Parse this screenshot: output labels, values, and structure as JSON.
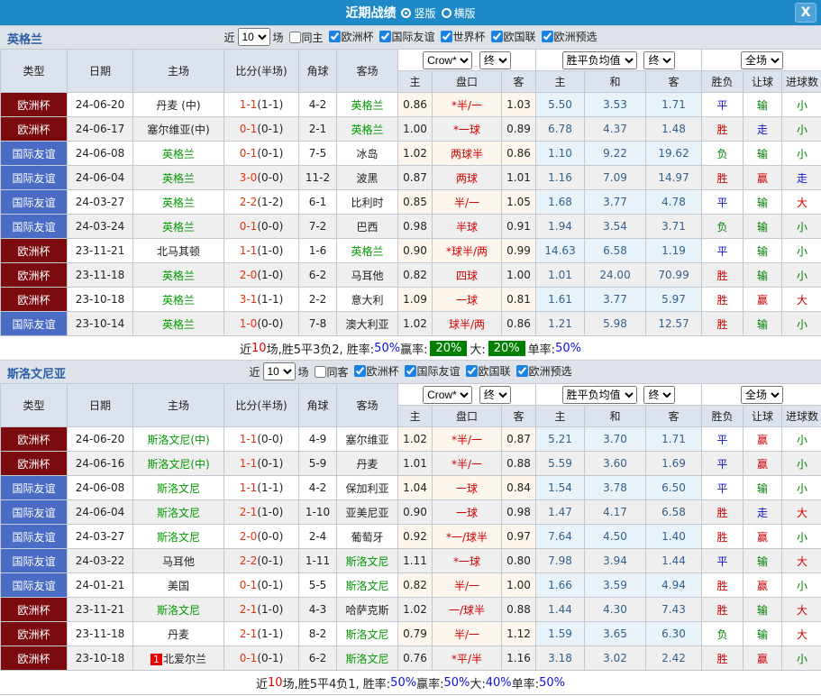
{
  "title_bar": {
    "title": "近期战绩",
    "view_options": [
      {
        "label": "竖版",
        "selected": true
      },
      {
        "label": "横版",
        "selected": false
      }
    ],
    "close_label": "X"
  },
  "colors": {
    "titlebar_bg": "#1e8bc8",
    "europe_cup_bg": "#7c0b10",
    "friendly_bg": "#4b6cc4",
    "team_highlight": "#009900",
    "score_ft": "#e53311",
    "handicap_text": "#d40000",
    "avg_text": "#33618c",
    "badge_bg": "#008000"
  },
  "type_colors": {
    "欧洲杯": "#7c0b10",
    "国际友谊": "#4b6cc4"
  },
  "result_colors": {
    "胜": "#cc0000",
    "平": "#1111cc",
    "负": "#008000",
    "赢": "#cc0000",
    "走": "#1111cc",
    "输": "#008000",
    "大": "#cc0000",
    "小": "#008000"
  },
  "table_headers": {
    "type": "类型",
    "date": "日期",
    "home": "主场",
    "score": "比分(半场)",
    "corner": "角球",
    "away": "客场",
    "odds_company": "Crow*",
    "final": "终",
    "avg": "胜平负均值",
    "full": "全场",
    "sub": [
      "主",
      "盘口",
      "客",
      "主",
      "和",
      "客",
      "胜负",
      "让球",
      "进球数"
    ]
  },
  "sections": [
    {
      "team": "英格兰",
      "filter": {
        "recent_label": "近",
        "recent_value": "10",
        "matches_label": "场",
        "same_venue": {
          "label": "同主",
          "checked": false
        },
        "competitions": [
          {
            "label": "欧洲杯",
            "checked": true
          },
          {
            "label": "国际友谊",
            "checked": true
          },
          {
            "label": "世界杯",
            "checked": true
          },
          {
            "label": "欧国联",
            "checked": true
          },
          {
            "label": "欧洲预选",
            "checked": true
          }
        ]
      },
      "rows": [
        {
          "type": "欧洲杯",
          "date": "24-06-20",
          "home": "丹麦 (中)",
          "home_hl": false,
          "score_ft": "1-1",
          "score_ht": "(1-1)",
          "corner": "4-2",
          "away": "英格兰",
          "away_hl": true,
          "odds_home": "0.86",
          "handicap": "*半/一",
          "odds_away": "1.03",
          "avg_home": "5.50",
          "avg_draw": "3.53",
          "avg_away": "1.71",
          "res_wdl": "平",
          "res_handicap": "输",
          "res_goal": "小"
        },
        {
          "type": "欧洲杯",
          "date": "24-06-17",
          "home": "塞尔维亚(中)",
          "home_hl": false,
          "score_ft": "0-1",
          "score_ht": "(0-1)",
          "corner": "2-1",
          "away": "英格兰",
          "away_hl": true,
          "odds_home": "1.00",
          "handicap": "*一球",
          "odds_away": "0.89",
          "avg_home": "6.78",
          "avg_draw": "4.37",
          "avg_away": "1.48",
          "res_wdl": "胜",
          "res_handicap": "走",
          "res_goal": "小"
        },
        {
          "type": "国际友谊",
          "date": "24-06-08",
          "home": "英格兰",
          "home_hl": true,
          "score_ft": "0-1",
          "score_ht": "(0-1)",
          "corner": "7-5",
          "away": "冰岛",
          "away_hl": false,
          "odds_home": "1.02",
          "handicap": "两球半",
          "odds_away": "0.86",
          "avg_home": "1.10",
          "avg_draw": "9.22",
          "avg_away": "19.62",
          "res_wdl": "负",
          "res_handicap": "输",
          "res_goal": "小"
        },
        {
          "type": "国际友谊",
          "date": "24-06-04",
          "home": "英格兰",
          "home_hl": true,
          "score_ft": "3-0",
          "score_ht": "(0-0)",
          "corner": "11-2",
          "away": "波黑",
          "away_hl": false,
          "odds_home": "0.87",
          "handicap": "两球",
          "odds_away": "1.01",
          "avg_home": "1.16",
          "avg_draw": "7.09",
          "avg_away": "14.97",
          "res_wdl": "胜",
          "res_handicap": "赢",
          "res_goal": "走"
        },
        {
          "type": "国际友谊",
          "date": "24-03-27",
          "home": "英格兰",
          "home_hl": true,
          "score_ft": "2-2",
          "score_ht": "(1-2)",
          "corner": "6-1",
          "away": "比利时",
          "away_hl": false,
          "odds_home": "0.85",
          "handicap": "半/一",
          "odds_away": "1.05",
          "avg_home": "1.68",
          "avg_draw": "3.77",
          "avg_away": "4.78",
          "res_wdl": "平",
          "res_handicap": "输",
          "res_goal": "大"
        },
        {
          "type": "国际友谊",
          "date": "24-03-24",
          "home": "英格兰",
          "home_hl": true,
          "score_ft": "0-1",
          "score_ht": "(0-0)",
          "corner": "7-2",
          "away": "巴西",
          "away_hl": false,
          "odds_home": "0.98",
          "handicap": "半球",
          "odds_away": "0.91",
          "avg_home": "1.94",
          "avg_draw": "3.54",
          "avg_away": "3.71",
          "res_wdl": "负",
          "res_handicap": "输",
          "res_goal": "小"
        },
        {
          "type": "欧洲杯",
          "date": "23-11-21",
          "home": "北马其顿",
          "home_hl": false,
          "score_ft": "1-1",
          "score_ht": "(1-0)",
          "corner": "1-6",
          "away": "英格兰",
          "away_hl": true,
          "odds_home": "0.90",
          "handicap": "*球半/两",
          "odds_away": "0.99",
          "avg_home": "14.63",
          "avg_draw": "6.58",
          "avg_away": "1.19",
          "res_wdl": "平",
          "res_handicap": "输",
          "res_goal": "小"
        },
        {
          "type": "欧洲杯",
          "date": "23-11-18",
          "home": "英格兰",
          "home_hl": true,
          "score_ft": "2-0",
          "score_ht": "(1-0)",
          "corner": "6-2",
          "away": "马耳他",
          "away_hl": false,
          "odds_home": "0.82",
          "handicap": "四球",
          "odds_away": "1.00",
          "avg_home": "1.01",
          "avg_draw": "24.00",
          "avg_away": "70.99",
          "res_wdl": "胜",
          "res_handicap": "输",
          "res_goal": "小"
        },
        {
          "type": "欧洲杯",
          "date": "23-10-18",
          "home": "英格兰",
          "home_hl": true,
          "score_ft": "3-1",
          "score_ht": "(1-1)",
          "corner": "2-2",
          "away": "意大利",
          "away_hl": false,
          "odds_home": "1.09",
          "handicap": "一球",
          "odds_away": "0.81",
          "avg_home": "1.61",
          "avg_draw": "3.77",
          "avg_away": "5.97",
          "res_wdl": "胜",
          "res_handicap": "赢",
          "res_goal": "大"
        },
        {
          "type": "国际友谊",
          "date": "23-10-14",
          "home": "英格兰",
          "home_hl": true,
          "score_ft": "1-0",
          "score_ht": "(0-0)",
          "corner": "7-8",
          "away": "澳大利亚",
          "away_hl": false,
          "odds_home": "1.02",
          "handicap": "球半/两",
          "odds_away": "0.86",
          "avg_home": "1.21",
          "avg_draw": "5.98",
          "avg_away": "12.57",
          "res_wdl": "胜",
          "res_handicap": "输",
          "res_goal": "小"
        }
      ],
      "summary": [
        {
          "text": "近",
          "style": "plain"
        },
        {
          "text": "10",
          "style": "red"
        },
        {
          "text": "场,胜5平3负2, 胜率:",
          "style": "plain"
        },
        {
          "text": "50%",
          "style": "blue"
        },
        {
          "text": " 赢率:",
          "style": "plain"
        },
        {
          "text": "20%",
          "style": "badge"
        },
        {
          "text": " 大:",
          "style": "plain"
        },
        {
          "text": "20%",
          "style": "badge"
        },
        {
          "text": " 单率:",
          "style": "plain"
        },
        {
          "text": "50%",
          "style": "blue"
        }
      ]
    },
    {
      "team": "斯洛文尼亚",
      "filter": {
        "recent_label": "近",
        "recent_value": "10",
        "matches_label": "场",
        "same_venue": {
          "label": "同客",
          "checked": false
        },
        "competitions": [
          {
            "label": "欧洲杯",
            "checked": true
          },
          {
            "label": "国际友谊",
            "checked": true
          },
          {
            "label": "欧国联",
            "checked": true
          },
          {
            "label": "欧洲预选",
            "checked": true
          }
        ]
      },
      "rows": [
        {
          "type": "欧洲杯",
          "date": "24-06-20",
          "home": "斯洛文尼(中)",
          "home_hl": true,
          "score_ft": "1-1",
          "score_ht": "(0-0)",
          "corner": "4-9",
          "away": "塞尔维亚",
          "away_hl": false,
          "odds_home": "1.02",
          "handicap": "*半/一",
          "odds_away": "0.87",
          "avg_home": "5.21",
          "avg_draw": "3.70",
          "avg_away": "1.71",
          "res_wdl": "平",
          "res_handicap": "赢",
          "res_goal": "小"
        },
        {
          "type": "欧洲杯",
          "date": "24-06-16",
          "home": "斯洛文尼(中)",
          "home_hl": true,
          "score_ft": "1-1",
          "score_ht": "(0-1)",
          "corner": "5-9",
          "away": "丹麦",
          "away_hl": false,
          "odds_home": "1.01",
          "handicap": "*半/一",
          "odds_away": "0.88",
          "avg_home": "5.59",
          "avg_draw": "3.60",
          "avg_away": "1.69",
          "res_wdl": "平",
          "res_handicap": "赢",
          "res_goal": "小"
        },
        {
          "type": "国际友谊",
          "date": "24-06-08",
          "home": "斯洛文尼",
          "home_hl": true,
          "score_ft": "1-1",
          "score_ht": "(1-1)",
          "corner": "4-2",
          "away": "保加利亚",
          "away_hl": false,
          "odds_home": "1.04",
          "handicap": "一球",
          "odds_away": "0.84",
          "avg_home": "1.54",
          "avg_draw": "3.78",
          "avg_away": "6.50",
          "res_wdl": "平",
          "res_handicap": "输",
          "res_goal": "小"
        },
        {
          "type": "国际友谊",
          "date": "24-06-04",
          "home": "斯洛文尼",
          "home_hl": true,
          "score_ft": "2-1",
          "score_ht": "(1-0)",
          "corner": "1-10",
          "away": "亚美尼亚",
          "away_hl": false,
          "odds_home": "0.90",
          "handicap": "一球",
          "odds_away": "0.98",
          "avg_home": "1.47",
          "avg_draw": "4.17",
          "avg_away": "6.58",
          "res_wdl": "胜",
          "res_handicap": "走",
          "res_goal": "大"
        },
        {
          "type": "国际友谊",
          "date": "24-03-27",
          "home": "斯洛文尼",
          "home_hl": true,
          "score_ft": "2-0",
          "score_ht": "(0-0)",
          "corner": "2-4",
          "away": "葡萄牙",
          "away_hl": false,
          "odds_home": "0.92",
          "handicap": "*一/球半",
          "odds_away": "0.97",
          "avg_home": "7.64",
          "avg_draw": "4.50",
          "avg_away": "1.40",
          "res_wdl": "胜",
          "res_handicap": "赢",
          "res_goal": "小"
        },
        {
          "type": "国际友谊",
          "date": "24-03-22",
          "home": "马耳他",
          "home_hl": false,
          "score_ft": "2-2",
          "score_ht": "(0-1)",
          "corner": "1-11",
          "away": "斯洛文尼",
          "away_hl": true,
          "odds_home": "1.11",
          "handicap": "*一球",
          "odds_away": "0.80",
          "avg_home": "7.98",
          "avg_draw": "3.94",
          "avg_away": "1.44",
          "res_wdl": "平",
          "res_handicap": "输",
          "res_goal": "大"
        },
        {
          "type": "国际友谊",
          "date": "24-01-21",
          "home": "美国",
          "home_hl": false,
          "score_ft": "0-1",
          "score_ht": "(0-1)",
          "corner": "5-5",
          "away": "斯洛文尼",
          "away_hl": true,
          "odds_home": "0.82",
          "handicap": "半/一",
          "odds_away": "1.00",
          "avg_home": "1.66",
          "avg_draw": "3.59",
          "avg_away": "4.94",
          "res_wdl": "胜",
          "res_handicap": "赢",
          "res_goal": "小"
        },
        {
          "type": "欧洲杯",
          "date": "23-11-21",
          "home": "斯洛文尼",
          "home_hl": true,
          "score_ft": "2-1",
          "score_ht": "(1-0)",
          "corner": "4-3",
          "away": "哈萨克斯",
          "away_hl": false,
          "odds_home": "1.02",
          "handicap": "一/球半",
          "odds_away": "0.88",
          "avg_home": "1.44",
          "avg_draw": "4.30",
          "avg_away": "7.43",
          "res_wdl": "胜",
          "res_handicap": "输",
          "res_goal": "大"
        },
        {
          "type": "欧洲杯",
          "date": "23-11-18",
          "home": "丹麦",
          "home_hl": false,
          "score_ft": "2-1",
          "score_ht": "(1-1)",
          "corner": "8-2",
          "away": "斯洛文尼",
          "away_hl": true,
          "odds_home": "0.79",
          "handicap": "半/一",
          "odds_away": "1.12",
          "avg_home": "1.59",
          "avg_draw": "3.65",
          "avg_away": "6.30",
          "res_wdl": "负",
          "res_handicap": "输",
          "res_goal": "大"
        },
        {
          "type": "欧洲杯",
          "date": "23-10-18",
          "home": "北爱尔兰",
          "home_hl": false,
          "home_red": "1",
          "score_ft": "0-1",
          "score_ht": "(0-1)",
          "corner": "6-2",
          "away": "斯洛文尼",
          "away_hl": true,
          "odds_home": "0.76",
          "handicap": "*平/半",
          "odds_away": "1.16",
          "avg_home": "3.18",
          "avg_draw": "3.02",
          "avg_away": "2.42",
          "res_wdl": "胜",
          "res_handicap": "赢",
          "res_goal": "小"
        }
      ],
      "summary": [
        {
          "text": "近",
          "style": "plain"
        },
        {
          "text": "10",
          "style": "red"
        },
        {
          "text": "场,胜5平4负1, 胜率:",
          "style": "plain"
        },
        {
          "text": "50%",
          "style": "blue"
        },
        {
          "text": " 赢率:",
          "style": "plain"
        },
        {
          "text": "50%",
          "style": "blue"
        },
        {
          "text": " 大:",
          "style": "plain"
        },
        {
          "text": "40%",
          "style": "blue"
        },
        {
          "text": " 单率:",
          "style": "plain"
        },
        {
          "text": "50%",
          "style": "blue"
        }
      ]
    }
  ]
}
